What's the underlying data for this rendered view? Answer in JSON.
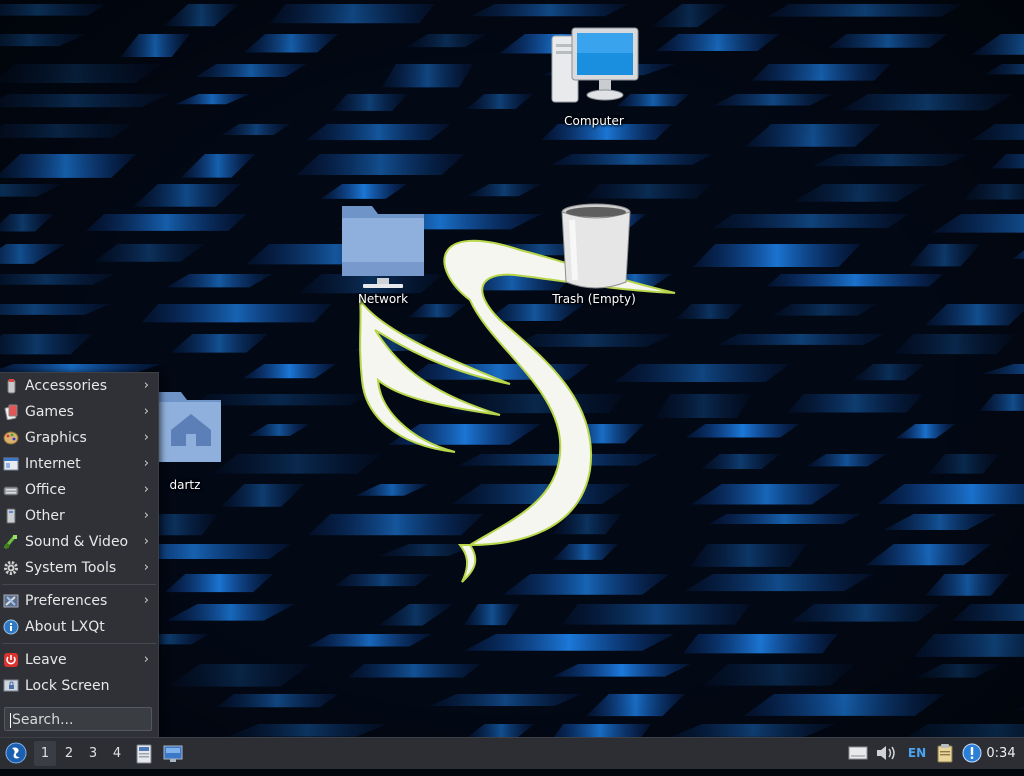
{
  "desktop": {
    "icons": [
      {
        "id": "computer",
        "label": "Computer"
      },
      {
        "id": "network",
        "label": "Network"
      },
      {
        "id": "trash",
        "label": "Trash (Empty)"
      },
      {
        "id": "home",
        "label": "dartz"
      }
    ]
  },
  "menu": {
    "categories": [
      {
        "label": "Accessories",
        "icon": "accessories-icon",
        "submenu": true
      },
      {
        "label": "Games",
        "icon": "games-icon",
        "submenu": true
      },
      {
        "label": "Graphics",
        "icon": "graphics-icon",
        "submenu": true
      },
      {
        "label": "Internet",
        "icon": "internet-icon",
        "submenu": true
      },
      {
        "label": "Office",
        "icon": "office-icon",
        "submenu": true
      },
      {
        "label": "Other",
        "icon": "other-icon",
        "submenu": true
      },
      {
        "label": "Sound & Video",
        "icon": "sound-video-icon",
        "submenu": true
      },
      {
        "label": "System Tools",
        "icon": "system-tools-icon",
        "submenu": true
      }
    ],
    "settings": [
      {
        "label": "Preferences",
        "icon": "preferences-icon",
        "submenu": true
      },
      {
        "label": "About LXQt",
        "icon": "about-icon",
        "submenu": false
      }
    ],
    "session": [
      {
        "label": "Leave",
        "icon": "leave-icon",
        "submenu": true
      },
      {
        "label": "Lock Screen",
        "icon": "lock-screen-icon",
        "submenu": false
      }
    ],
    "search_placeholder": "Search...",
    "arrow": "›"
  },
  "taskbar": {
    "desktops": [
      "1",
      "2",
      "3",
      "4"
    ],
    "active_desktop": "1",
    "keyboard_layout": "EN",
    "clock": "0:34"
  },
  "colors": {
    "panel_bg": "#2c2e33",
    "menu_bg": "#2f3136",
    "wallpaper_accent": "#1e7be8"
  }
}
